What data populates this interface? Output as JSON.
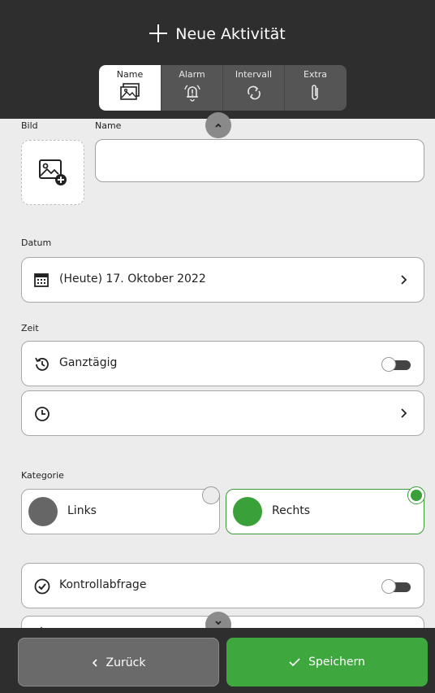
{
  "header": {
    "title": "Neue Aktivität"
  },
  "tabs": [
    {
      "label": "Name",
      "icon": "image-icon"
    },
    {
      "label": "Alarm",
      "icon": "alarm-bell-icon"
    },
    {
      "label": "Intervall",
      "icon": "repeat-icon"
    },
    {
      "label": "Extra",
      "icon": "paperclip-icon"
    }
  ],
  "form": {
    "bild_label": "Bild",
    "name_label": "Name",
    "name_value": "",
    "datum_label": "Datum",
    "datum_value": "(Heute) 17. Oktober 2022",
    "zeit_label": "Zeit",
    "ganztaegig_label": "Ganztägig",
    "ganztaegig_on": false,
    "time_value": "",
    "kategorie_label": "Kategorie",
    "categories": [
      {
        "label": "Links",
        "color": "#666666",
        "selected": false
      },
      {
        "label": "Rechts",
        "color": "#3aa03a",
        "selected": true
      }
    ],
    "kontroll_label": "Kontrollabfrage",
    "kontroll_on": false
  },
  "footer": {
    "back_label": "Zurück",
    "save_label": "Speichern"
  },
  "colors": {
    "header_bg": "#2e2e2e",
    "accent": "#3ea83e",
    "background": "#ececec"
  }
}
